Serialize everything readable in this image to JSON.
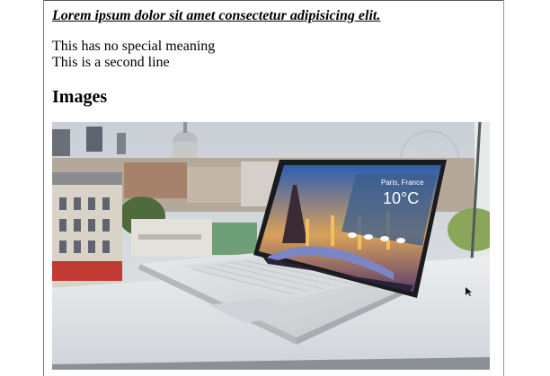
{
  "document": {
    "headline": "Lorem ipsum dolor sit amet consectetur adipisicing elit.",
    "paragraph_lines": [
      "This has no special meaning",
      "This is a second line"
    ],
    "section_title": "Images"
  },
  "image": {
    "weather_city": "Paris, France",
    "weather_temp": "10°C"
  }
}
